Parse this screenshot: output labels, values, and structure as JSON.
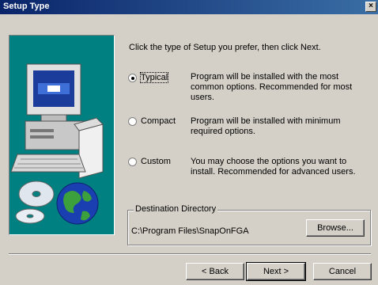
{
  "window": {
    "title": "Setup Type",
    "close_glyph": "×"
  },
  "instruction": "Click the type of Setup you prefer, then click Next.",
  "options": [
    {
      "label": "Typical",
      "selected": true,
      "description": "Program will be installed with the most common options. Recommended for most users."
    },
    {
      "label": "Compact",
      "selected": false,
      "description": "Program will be installed with minimum required options."
    },
    {
      "label": "Custom",
      "selected": false,
      "description": "You may choose the options you want to install. Recommended for advanced users."
    }
  ],
  "destination": {
    "legend": "Destination Directory",
    "path": "C:\\Program Files\\SnapOnFGA",
    "browse_label": "Browse..."
  },
  "buttons": {
    "back": "< Back",
    "next": "Next >",
    "cancel": "Cancel"
  },
  "icons": [
    "computer-illustration",
    "cd-disc-illustration",
    "globe-illustration"
  ],
  "colors": {
    "titlebar": "#0a246a",
    "panel": "#d4d0c8",
    "illustration_bg": "#008080"
  }
}
